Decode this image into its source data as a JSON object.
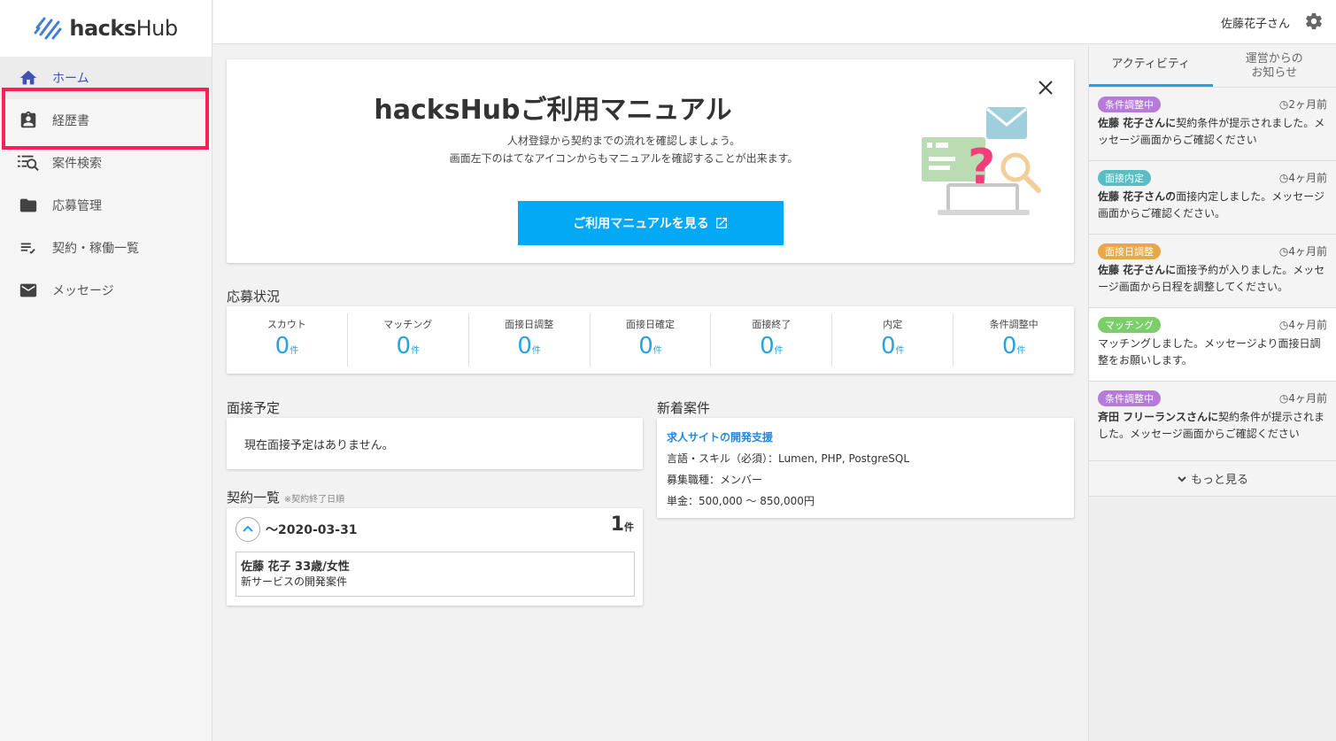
{
  "logo": {
    "text_bold": "hacks",
    "text_light": "Hub"
  },
  "sidebar": {
    "items": [
      {
        "label": "ホーム",
        "icon": "home-icon"
      },
      {
        "label": "経歴書",
        "icon": "clipboard-account-icon"
      },
      {
        "label": "案件検索",
        "icon": "list-search-icon"
      },
      {
        "label": "応募管理",
        "icon": "folder-icon"
      },
      {
        "label": "契約・稼働一覧",
        "icon": "playlist-check-icon"
      },
      {
        "label": "メッセージ",
        "icon": "mail-icon"
      }
    ]
  },
  "header": {
    "user_name": "佐藤花子さん"
  },
  "manual": {
    "title": "hacksHubご利用マニュアル",
    "desc_line1": "人材登録から契約までの流れを確認しましょう。",
    "desc_line2": "画面左下のはてなアイコンからもマニュアルを確認することが出来ます。",
    "button_label": "ご利用マニュアルを見る"
  },
  "status": {
    "heading": "応募状況",
    "unit": "件",
    "cells": [
      {
        "label": "スカウト",
        "value": "0"
      },
      {
        "label": "マッチング",
        "value": "0"
      },
      {
        "label": "面接日調整",
        "value": "0"
      },
      {
        "label": "面接日確定",
        "value": "0"
      },
      {
        "label": "面接終了",
        "value": "0"
      },
      {
        "label": "内定",
        "value": "0"
      },
      {
        "label": "条件調整中",
        "value": "0"
      }
    ]
  },
  "interview": {
    "heading": "面接予定",
    "empty_text": "現在面接予定はありません。"
  },
  "jobs": {
    "heading": "新着案件",
    "title": "求人サイトの開発支援",
    "skills": "言語・スキル（必須）：Lumen, PHP, PostgreSQL",
    "role": "募集職種：メンバー",
    "price": "単金：500,000 〜 850,000円"
  },
  "contracts": {
    "heading": "契約一覧",
    "note": "※契約終了日順",
    "period": "〜2020-03-31",
    "count": "1",
    "unit": "件",
    "person": "佐藤 花子 33歳/女性",
    "project": "新サービスの開発案件"
  },
  "activity": {
    "tab_active": "アクティビティ",
    "tab_other_line1": "運営からの",
    "tab_other_line2": "お知らせ",
    "more": "もっと見る",
    "items": [
      {
        "badge": "条件調整中",
        "badge_color": "#b57bd6",
        "time": "2ヶ月前",
        "bold": "佐藤 花子さんに",
        "text": "契約条件が提示されました。メッセージ画面からご確認ください"
      },
      {
        "badge": "面接内定",
        "badge_color": "#5bbcc4",
        "time": "4ヶ月前",
        "bold": "佐藤 花子さんの",
        "text": "面接内定しました。メッセージ画面からご確認ください。"
      },
      {
        "badge": "面接日調整",
        "badge_color": "#e8a84a",
        "time": "4ヶ月前",
        "bold": "佐藤 花子さんに",
        "text": "面接予約が入りました。メッセージ画面から日程を調整してください。"
      },
      {
        "badge": "マッチング",
        "badge_color": "#7ccd6b",
        "time": "4ヶ月前",
        "bold": "",
        "text": "マッチングしました。メッセージより面接日調整をお願いします。"
      },
      {
        "badge": "条件調整中",
        "badge_color": "#b57bd6",
        "time": "4ヶ月前",
        "bold": "斉田 フリーランスさんに",
        "text": "契約条件が提示されました。メッセージ画面からご確認ください"
      }
    ]
  }
}
